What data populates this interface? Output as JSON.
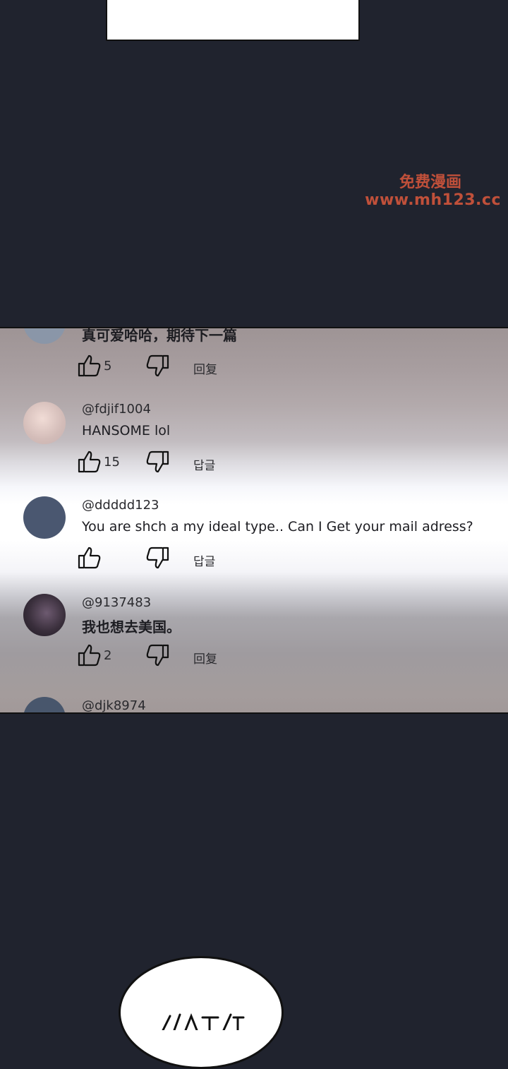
{
  "watermark": {
    "line1": "免费漫画",
    "line2": "www.mh123.cc"
  },
  "comments": [
    {
      "user": "",
      "text": "真可爱哈哈，期待下一篇",
      "likes": "5",
      "reply_label": "回复",
      "avatar_color": "#8a96a8"
    },
    {
      "user": "@fdjif1004",
      "text": "HANSOME lol",
      "likes": "15",
      "reply_label": "답글",
      "avatar_color": "#d9c4c0"
    },
    {
      "user": "@ddddd123",
      "text": "You are shch a my ideal type.. Can I Get your mail adress?",
      "likes": "",
      "reply_label": "답글",
      "avatar_color": "#4a5770"
    },
    {
      "user": "@9137483",
      "text": "我也想去美国。",
      "likes": "2",
      "reply_label": "回复",
      "avatar_color": "#2e2530"
    },
    {
      "user": "@djk8974",
      "text": "",
      "likes": "",
      "reply_label": "",
      "avatar_color": "#48566c"
    }
  ]
}
